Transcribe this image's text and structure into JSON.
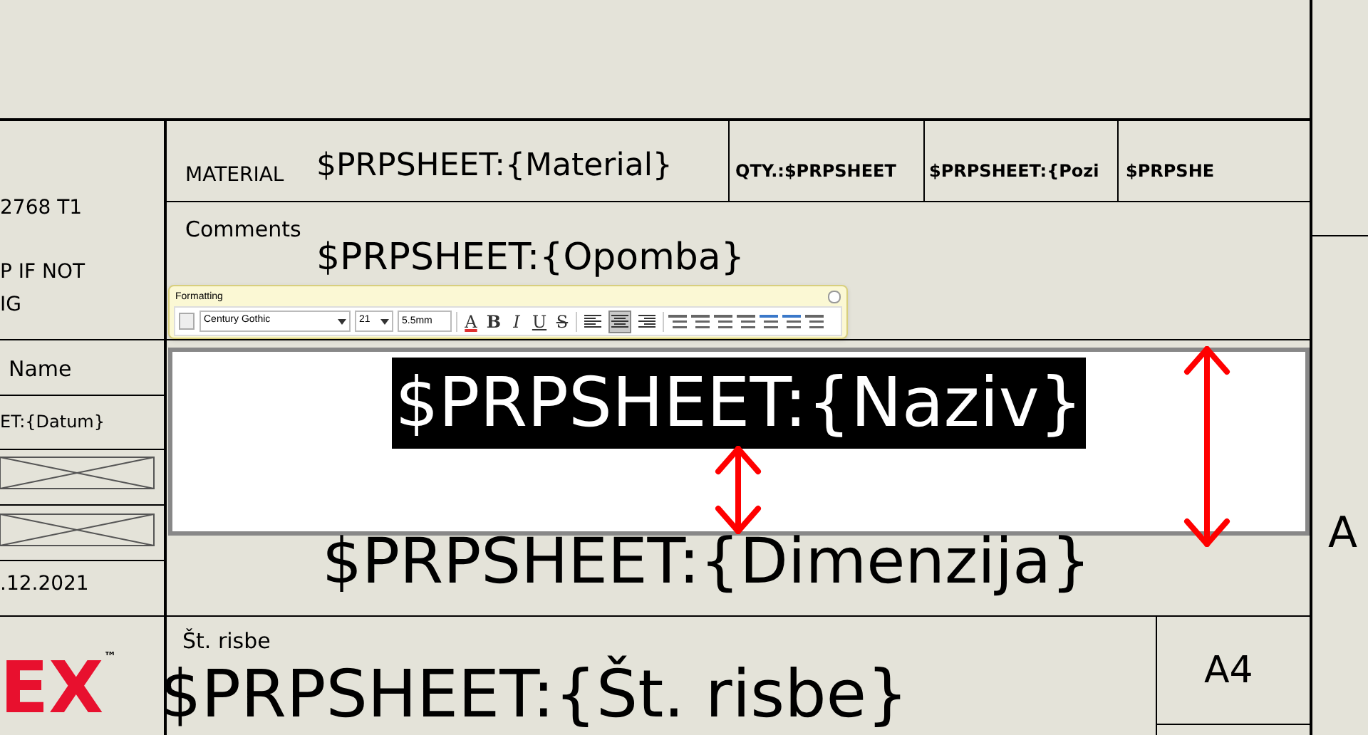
{
  "material_row": {
    "label": "MATERIAL",
    "value": "$PRPSHEET:{Material}",
    "cells": [
      "QTY.:$PRPSHEET",
      "$PRPSHEET:{Pozi",
      "$PRPSHE"
    ]
  },
  "comments": {
    "label": "Comments",
    "value": "$PRPSHEET:{Opomba}"
  },
  "left_column": {
    "lines": [
      "2768 T1",
      "P IF NOT",
      "IG"
    ],
    "name_label": "Name",
    "name_value": "ET:{Datum}",
    "date": ".12.2021"
  },
  "formatting_toolbar": {
    "title": "Formatting",
    "font": "Century Gothic",
    "size": "21",
    "height": "5.5mm",
    "styles": [
      {
        "label": "A",
        "kind": "color"
      },
      {
        "label": "B",
        "kind": "bold"
      },
      {
        "label": "I",
        "kind": "italic"
      },
      {
        "label": "U",
        "kind": "underline"
      },
      {
        "label": "S",
        "kind": "strike"
      }
    ],
    "alignment": [
      {
        "kind": "left",
        "selected": false
      },
      {
        "kind": "center",
        "selected": true
      },
      {
        "kind": "right",
        "selected": false
      }
    ]
  },
  "title_box": {
    "value": "$PRPSHEET:{Naziv}",
    "selected": true
  },
  "dimension": "$PRPSHEET:{Dimenzija}",
  "drawing_number": {
    "label": "Št. risbe",
    "value": "$PRPSHEET:{Št. risbe}"
  },
  "sheet_size": "A4",
  "revision": "A",
  "logo": {
    "text": "EX",
    "trademark": "™"
  }
}
